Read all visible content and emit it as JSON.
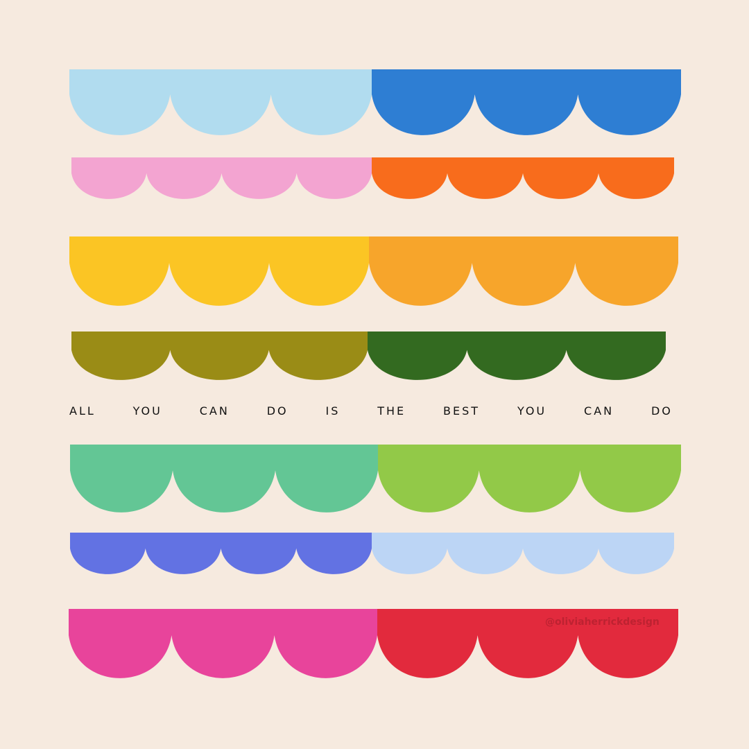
{
  "quote_words": [
    "ALL",
    "YOU",
    "CAN",
    "DO",
    "IS",
    "THE",
    "BEST",
    "YOU",
    "CAN",
    "DO"
  ],
  "watermark": "@oliviaherrickdesign",
  "colors": {
    "background": "#f6eadf",
    "scallops": [
      [
        "#b1dcef",
        "#2e7ed3"
      ],
      [
        "#f3a4d1",
        "#f86c1c"
      ],
      [
        "#fbc524",
        "#f7a52b"
      ],
      [
        "#9a8c16",
        "#336a20"
      ],
      [
        "#63c695",
        "#92c948"
      ],
      [
        "#6272e3",
        "#bcd5f5"
      ],
      [
        "#e8449b",
        "#e22a3d"
      ]
    ]
  }
}
